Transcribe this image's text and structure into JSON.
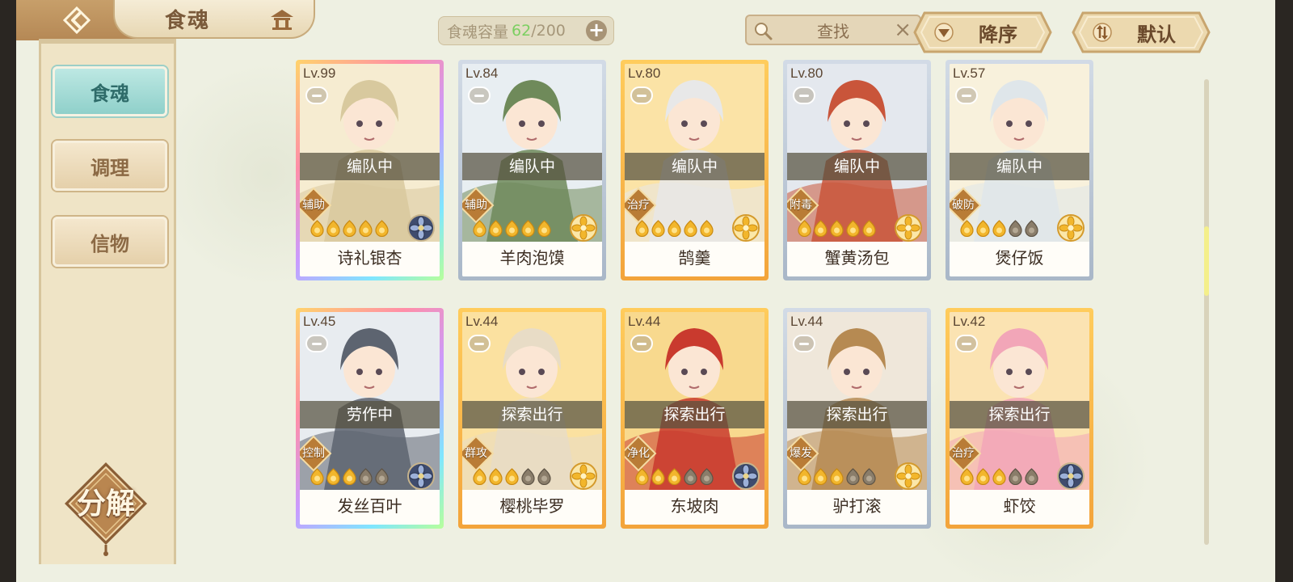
{
  "header": {
    "title": "食魂",
    "capacity_label": "食魂容量",
    "capacity_used": "62",
    "capacity_total": "/200",
    "search_label": "查找",
    "sort_label": "降序",
    "filter_label": "默认"
  },
  "sidebar": {
    "tabs": [
      {
        "label": "食魂"
      },
      {
        "label": "调理"
      },
      {
        "label": "信物"
      }
    ],
    "decompose_label": "分解"
  },
  "cards": [
    {
      "level": "Lv.99",
      "status": "编队中",
      "role": "辅助",
      "name": "诗礼银杏",
      "stars": 5,
      "max_stars": 5,
      "rarity": "rainbow",
      "emblem": "blue",
      "palette": [
        "#f6ecd1",
        "#d8c99e"
      ]
    },
    {
      "level": "Lv.84",
      "status": "编队中",
      "role": "辅助",
      "name": "羊肉泡馍",
      "stars": 5,
      "max_stars": 5,
      "rarity": "blue",
      "emblem": "gold",
      "palette": [
        "#e8eef2",
        "#6f8a5a"
      ]
    },
    {
      "level": "Lv.80",
      "status": "编队中",
      "role": "治疗",
      "name": "鹄羹",
      "stars": 5,
      "max_stars": 5,
      "rarity": "gold",
      "emblem": "gold",
      "palette": [
        "#fbe3a6",
        "#e8e8e8"
      ]
    },
    {
      "level": "Lv.80",
      "status": "编队中",
      "role": "附毒",
      "name": "蟹黄汤包",
      "stars": 5,
      "max_stars": 5,
      "rarity": "blue",
      "emblem": "gold",
      "palette": [
        "#e4e8ee",
        "#c9553a"
      ]
    },
    {
      "level": "Lv.57",
      "status": "编队中",
      "role": "破防",
      "name": "煲仔饭",
      "stars": 3,
      "max_stars": 5,
      "rarity": "blue",
      "emblem": "gold",
      "palette": [
        "#f8f1dc",
        "#dfe6ea"
      ]
    },
    {
      "level": "Lv.45",
      "status": "劳作中",
      "role": "控制",
      "name": "发丝百叶",
      "stars": 3,
      "max_stars": 5,
      "rarity": "rainbow",
      "emblem": "blue",
      "palette": [
        "#e8ecf0",
        "#5d6470"
      ]
    },
    {
      "level": "Lv.44",
      "status": "探索出行",
      "role": "群攻",
      "name": "樱桃毕罗",
      "stars": 3,
      "max_stars": 5,
      "rarity": "gold",
      "emblem": "gold",
      "palette": [
        "#fbe1a0",
        "#e8dcc6"
      ]
    },
    {
      "level": "Lv.44",
      "status": "探索出行",
      "role": "净化",
      "name": "东坡肉",
      "stars": 3,
      "max_stars": 5,
      "rarity": "gold",
      "emblem": "blue",
      "palette": [
        "#f8d98e",
        "#c93a2e"
      ]
    },
    {
      "level": "Lv.44",
      "status": "探索出行",
      "role": "爆发",
      "name": "驴打滚",
      "stars": 3,
      "max_stars": 5,
      "rarity": "blue",
      "emblem": "gold",
      "palette": [
        "#efe7da",
        "#b68a52"
      ]
    },
    {
      "level": "Lv.42",
      "status": "探索出行",
      "role": "治疗",
      "name": "虾饺",
      "stars": 3,
      "max_stars": 5,
      "rarity": "gold",
      "emblem": "blue",
      "palette": [
        "#fbe3b2",
        "#f2a6b8"
      ]
    }
  ],
  "colors": {
    "accent_teal": "#8fd0ca",
    "star_gold": "#f2b62c",
    "background": "#eef0e2"
  }
}
